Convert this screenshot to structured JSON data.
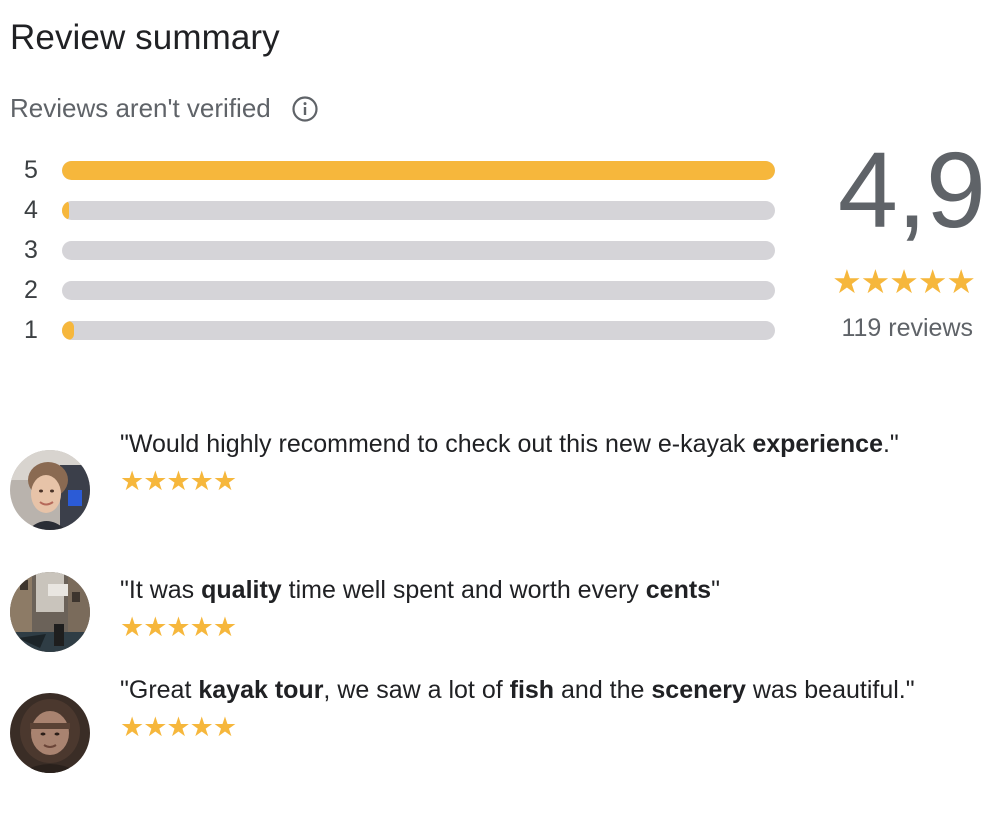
{
  "header": {
    "title": "Review summary",
    "verified_text": "Reviews aren't verified"
  },
  "distribution": [
    {
      "label": "5",
      "fraction": 1.0
    },
    {
      "label": "4",
      "fraction": 0.01
    },
    {
      "label": "3",
      "fraction": 0.0
    },
    {
      "label": "2",
      "fraction": 0.0
    },
    {
      "label": "1",
      "fraction": 0.017
    }
  ],
  "summary": {
    "score": "4,9",
    "stars": "★★★★★",
    "review_count": "119 reviews"
  },
  "reviews": [
    {
      "segments": [
        {
          "text": "\"Would highly recommend to check out this new e-kayak ",
          "bold": false
        },
        {
          "text": "experience",
          "bold": true
        },
        {
          "text": ".\"",
          "bold": false
        }
      ],
      "stars": "★★★★★"
    },
    {
      "segments": [
        {
          "text": "\"It was ",
          "bold": false
        },
        {
          "text": "quality",
          "bold": true
        },
        {
          "text": " time well spent and worth every ",
          "bold": false
        },
        {
          "text": "cents",
          "bold": true
        },
        {
          "text": "\"",
          "bold": false
        }
      ],
      "stars": "★★★★★"
    },
    {
      "segments": [
        {
          "text": "\"Great ",
          "bold": false
        },
        {
          "text": "kayak tour",
          "bold": true
        },
        {
          "text": ", we saw a lot of ",
          "bold": false
        },
        {
          "text": "fish",
          "bold": true
        },
        {
          "text": " and the ",
          "bold": false
        },
        {
          "text": "scenery",
          "bold": true
        },
        {
          "text": " was beautiful.\"",
          "bold": false
        }
      ],
      "stars": "★★★★★"
    }
  ],
  "colors": {
    "star": "#f6b73c",
    "bar_track": "#d5d4d8",
    "bar_fill": "#f6b73c"
  },
  "icons": {
    "info": "info-icon"
  }
}
